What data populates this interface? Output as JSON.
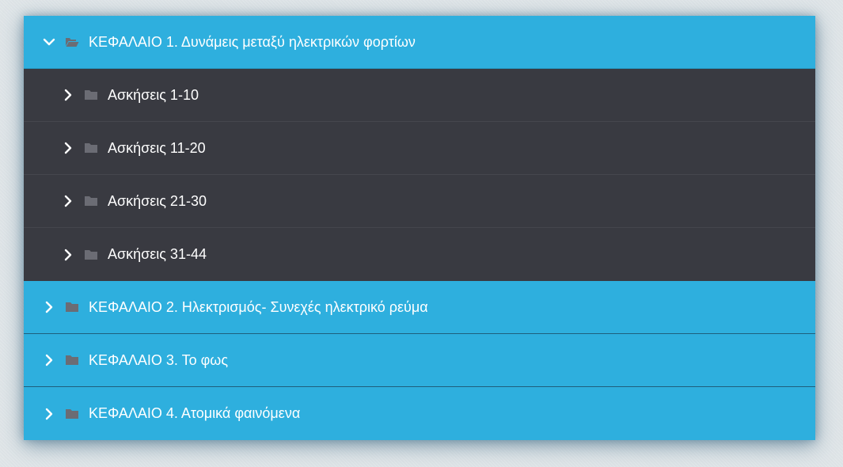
{
  "colors": {
    "chapter_bg": "#2eafde",
    "subitem_bg": "#393a41",
    "text": "#ffffff",
    "folder_icon": "#6b6c74"
  },
  "chapters": [
    {
      "label": "ΚΕΦΑΛΑΙΟ 1. Δυνάμεις μεταξύ ηλεκτρικών φορτίων",
      "expanded": true,
      "icon": "folder-open-icon",
      "items": [
        {
          "label": "Ασκήσεις 1-10",
          "icon": "folder-icon"
        },
        {
          "label": "Ασκήσεις 11-20",
          "icon": "folder-icon"
        },
        {
          "label": "Ασκήσεις 21-30",
          "icon": "folder-icon"
        },
        {
          "label": "Ασκήσεις 31-44",
          "icon": "folder-icon"
        }
      ]
    },
    {
      "label": "ΚΕΦΑΛΑΙΟ 2. Ηλεκτρισμός- Συνεχές ηλεκτρικό ρεύμα",
      "expanded": false,
      "icon": "folder-icon"
    },
    {
      "label": "ΚΕΦΑΛΑΙΟ 3. Το φως",
      "expanded": false,
      "icon": "folder-icon"
    },
    {
      "label": "ΚΕΦΑΛΑΙΟ 4. Ατομικά φαινόμενα",
      "expanded": false,
      "icon": "folder-icon"
    }
  ]
}
